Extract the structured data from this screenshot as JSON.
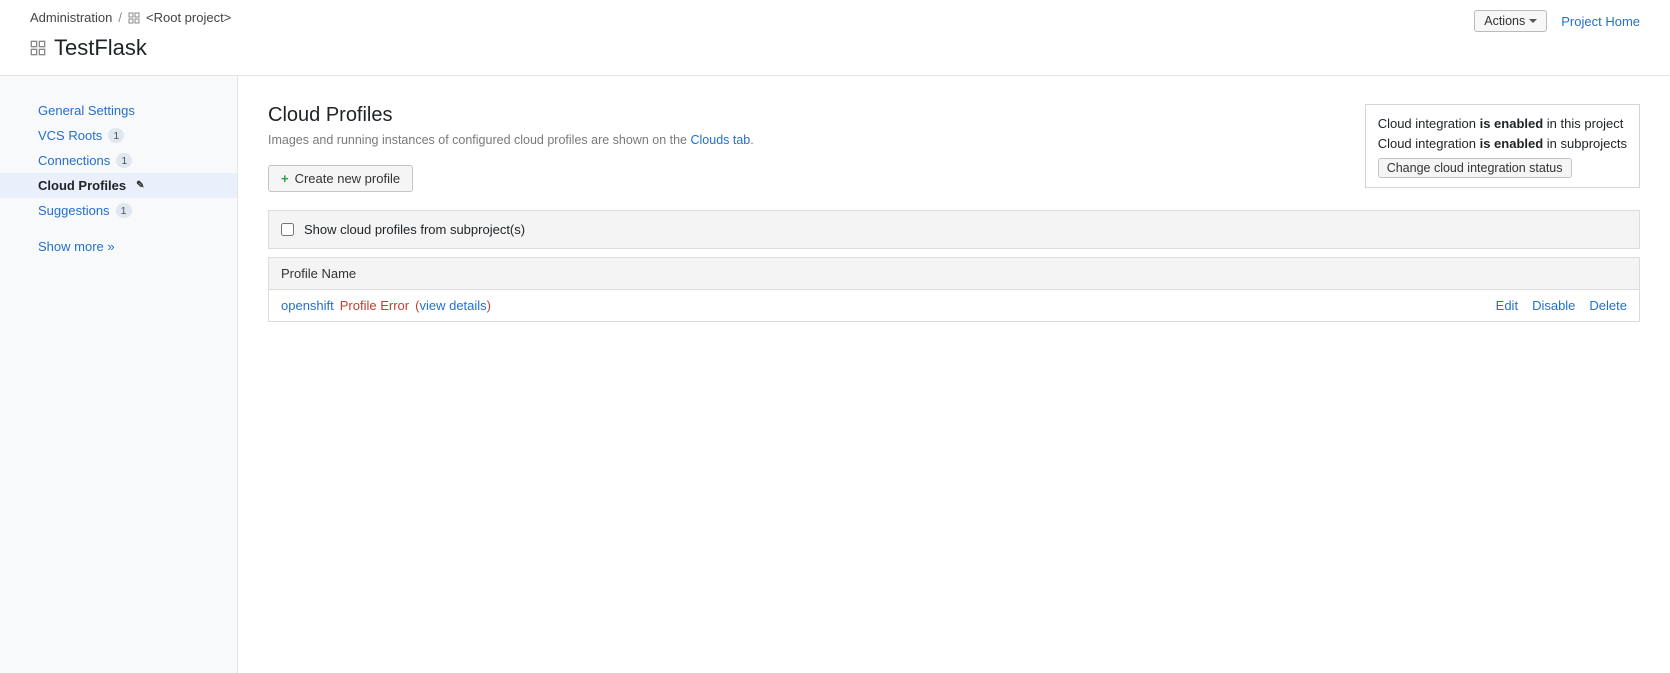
{
  "breadcrumb": {
    "admin": "Administration",
    "root": "<Root project>"
  },
  "header": {
    "project_title": "TestFlask",
    "actions_label": "Actions",
    "project_home": "Project Home"
  },
  "sidebar": {
    "items": [
      {
        "label": "General Settings",
        "count": null,
        "active": false
      },
      {
        "label": "VCS Roots",
        "count": "1",
        "active": false
      },
      {
        "label": "Connections",
        "count": "1",
        "active": false
      },
      {
        "label": "Cloud Profiles",
        "count": null,
        "active": true,
        "edited": true
      },
      {
        "label": "Suggestions",
        "count": "1",
        "active": false
      }
    ],
    "show_more": "Show more »"
  },
  "main": {
    "heading": "Cloud Profiles",
    "subtext_prefix": "Images and running instances of configured cloud profiles are shown on the ",
    "subtext_link": "Clouds tab",
    "subtext_suffix": ".",
    "create_button": "Create new profile",
    "checkbox_label": "Show cloud profiles from subproject(s)",
    "table_header": "Profile Name",
    "row": {
      "name": "openshift",
      "error": "Profile Error",
      "view_details": "view details",
      "edit": "Edit",
      "disable": "Disable",
      "delete": "Delete"
    }
  },
  "status": {
    "line1_prefix": "Cloud integration ",
    "line1_bold": "is enabled",
    "line1_suffix": " in this project",
    "line2_prefix": "Cloud integration ",
    "line2_bold": "is enabled",
    "line2_suffix": " in subprojects",
    "button": "Change cloud integration status"
  }
}
